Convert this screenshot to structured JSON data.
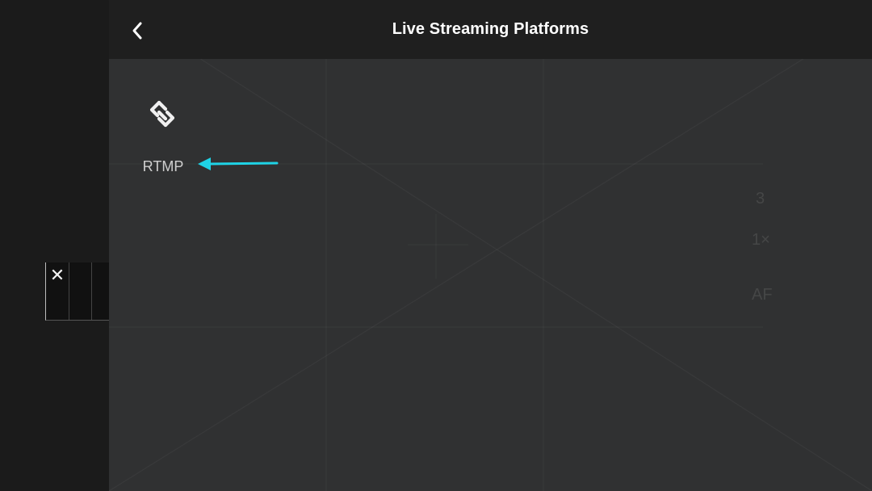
{
  "header": {
    "title": "Live Streaming Platforms",
    "back_icon": "chevron-left-icon"
  },
  "platforms": [
    {
      "label": "RTMP",
      "icon": "link-icon"
    }
  ],
  "camera_overlay": {
    "readout_top": "3",
    "zoom_label": "1×",
    "focus_label": "AF"
  },
  "mini_preview": {
    "close_icon": "close-icon",
    "close_glyph": "✕"
  },
  "annotation": {
    "arrow_color": "#1fd3e6"
  },
  "colors": {
    "panel_bg": "#303132",
    "header_bg": "#1f1f1f",
    "left_bg": "#1b1b1b"
  }
}
